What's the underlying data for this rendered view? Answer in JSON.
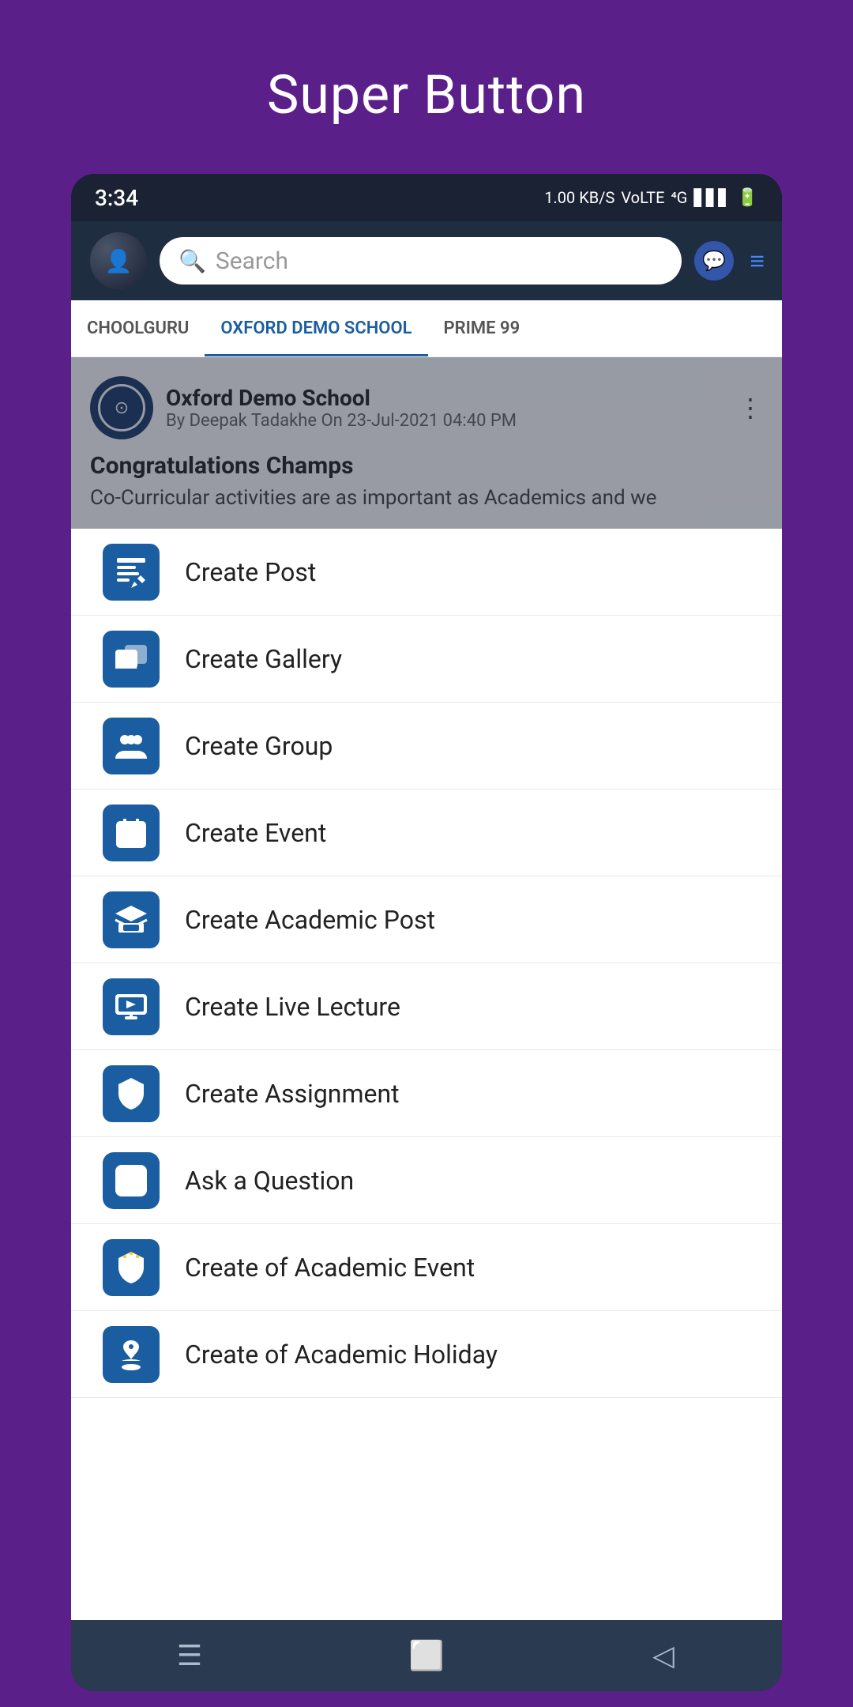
{
  "page": {
    "title": "Super Button"
  },
  "status_bar": {
    "time": "3:34",
    "signal_text": "1.00 KB/S",
    "network": "4G"
  },
  "top_bar": {
    "search_placeholder": "Search",
    "menu_icon": "☰"
  },
  "tabs": [
    {
      "label": "CHOOLGURU",
      "active": false
    },
    {
      "label": "OXFORD DEMO SCHOOL",
      "active": true
    },
    {
      "label": "PRIME 99",
      "active": false
    }
  ],
  "post": {
    "school": "Oxford Demo School",
    "author": "By Deepak Tadakhe On 23-Jul-2021 04:40 PM",
    "title": "Congratulations Champs",
    "body": "Co-Curricular activities are as important as Academics and we"
  },
  "menu_items": [
    {
      "id": "create-post",
      "label": "Create Post",
      "icon_type": "post"
    },
    {
      "id": "create-gallery",
      "label": "Create Gallery",
      "icon_type": "gallery"
    },
    {
      "id": "create-group",
      "label": "Create Group",
      "icon_type": "group"
    },
    {
      "id": "create-event",
      "label": "Create Event",
      "icon_type": "event"
    },
    {
      "id": "create-academic-post",
      "label": "Create Academic Post",
      "icon_type": "academic-post"
    },
    {
      "id": "create-live-lecture",
      "label": "Create Live Lecture",
      "icon_type": "live-lecture"
    },
    {
      "id": "create-assignment",
      "label": "Create Assignment",
      "icon_type": "assignment"
    },
    {
      "id": "ask-question",
      "label": "Ask a Question",
      "icon_type": "question"
    },
    {
      "id": "create-academic-event",
      "label": "Create of Academic Event",
      "icon_type": "academic-event"
    },
    {
      "id": "create-academic-holiday",
      "label": "Create of Academic Holiday",
      "icon_type": "academic-holiday"
    }
  ]
}
